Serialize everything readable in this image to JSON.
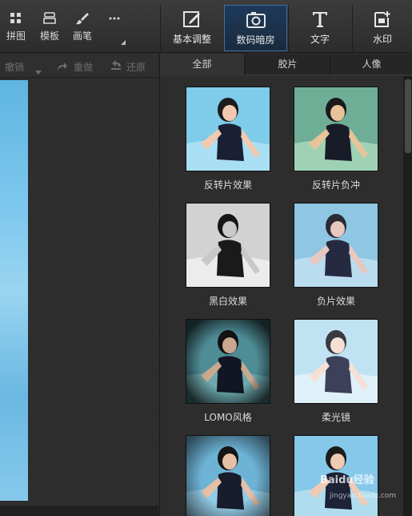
{
  "toolbar": {
    "left_tools": [
      {
        "label": "拼图",
        "icon": "grid-icon"
      },
      {
        "label": "模板",
        "icon": "template-icon"
      },
      {
        "label": "画笔",
        "icon": "brush-icon"
      },
      {
        "label": "",
        "icon": "more-icon"
      }
    ],
    "right_tabs": [
      {
        "label": "基本调整",
        "icon": "edit-icon"
      },
      {
        "label": "数码暗房",
        "icon": "camera-icon"
      },
      {
        "label": "文字",
        "icon": "text-icon"
      },
      {
        "label": "水印",
        "icon": "watermark-add-icon"
      }
    ],
    "active_tab": "数码暗房"
  },
  "undo_row": {
    "undo": "撤销",
    "redo": "重做",
    "restore": "还原"
  },
  "panel": {
    "subtabs": [
      "全部",
      "胶片",
      "人像"
    ],
    "active_subtab": "全部",
    "filters": [
      {
        "name": "反转片效果"
      },
      {
        "name": "反转片负冲"
      },
      {
        "name": "黑白效果"
      },
      {
        "name": "负片效果"
      },
      {
        "name": "LOMO风格"
      },
      {
        "name": "柔光镜"
      },
      {
        "name": ""
      },
      {
        "name": ""
      }
    ]
  },
  "watermark": {
    "text": "Baidu经验",
    "sub": "jingyan.baidu.com"
  },
  "colors": {
    "active_tab_border": "#3f6fa3",
    "pool_blue": "#7cc7ee"
  }
}
